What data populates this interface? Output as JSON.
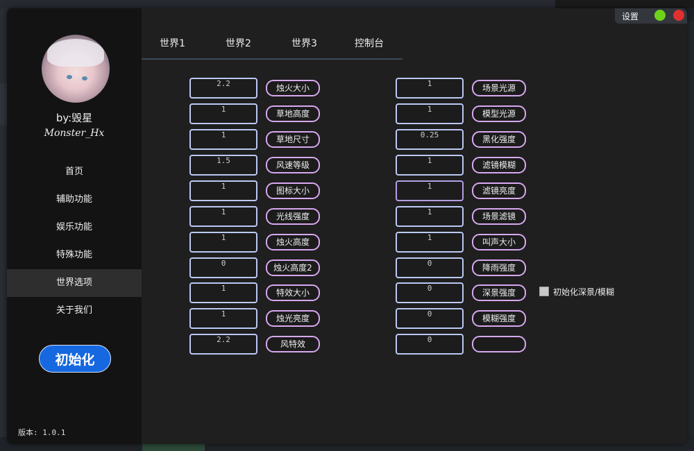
{
  "sidebar": {
    "byline": "by:毁星",
    "author": "Monster_Hx",
    "nav": [
      "首页",
      "辅助功能",
      "娱乐功能",
      "特殊功能",
      "世界选项",
      "关于我们"
    ],
    "active_index": 4,
    "init_button": "初始化",
    "version": "版本: 1.0.1"
  },
  "titlebar": {
    "settings": "设置",
    "colors": {
      "minimize": "#6fd11a",
      "close": "#e03030"
    }
  },
  "tabs": [
    "世界1",
    "世界2",
    "世界3",
    "控制台"
  ],
  "left_column": [
    {
      "value": "2.2",
      "label": "烛火大小"
    },
    {
      "value": "1",
      "label": "草地高度"
    },
    {
      "value": "1",
      "label": "草地尺寸"
    },
    {
      "value": "1.5",
      "label": "风速等级"
    },
    {
      "value": "1",
      "label": "图标大小"
    },
    {
      "value": "1",
      "label": "光线强度"
    },
    {
      "value": "1",
      "label": "烛火高度"
    },
    {
      "value": "0",
      "label": "烛火高度2"
    },
    {
      "value": "1",
      "label": "特效大小"
    },
    {
      "value": "1",
      "label": "烛光亮度"
    },
    {
      "value": "2.2",
      "label": "风特效"
    }
  ],
  "right_column": [
    {
      "value": "1",
      "label": "场景光源"
    },
    {
      "value": "1",
      "label": "模型光源"
    },
    {
      "value": "0.25",
      "label": "黑化强度"
    },
    {
      "value": "1",
      "label": "滤镜模糊"
    },
    {
      "value": "1",
      "label": "滤镜亮度"
    },
    {
      "value": "1",
      "label": "场景滤镜"
    },
    {
      "value": "1",
      "label": "叫声大小"
    },
    {
      "value": "0",
      "label": "降雨强度"
    },
    {
      "value": "0",
      "label": "深景强度"
    },
    {
      "value": "0",
      "label": "模糊强度"
    },
    {
      "value": "0",
      "label": ""
    }
  ],
  "checkbox": {
    "label": "初始化深景/模糊",
    "checked": false
  }
}
